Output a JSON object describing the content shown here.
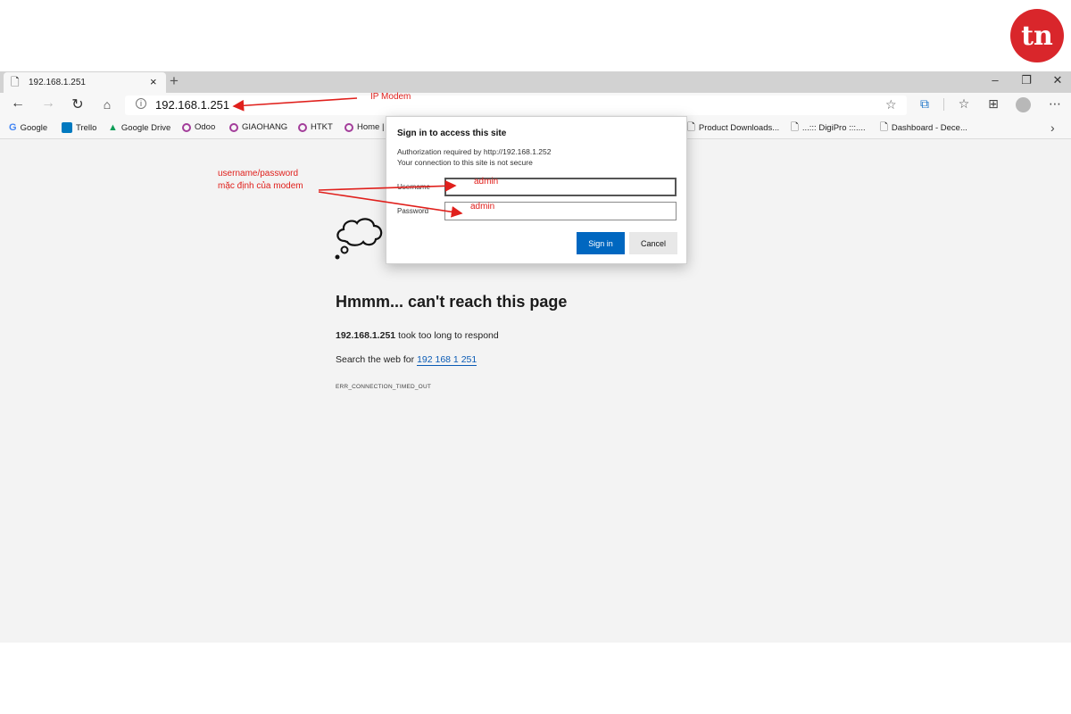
{
  "logo": {
    "text": "tn",
    "color": "#d9262b"
  },
  "browser": {
    "tab": {
      "title": "192.168.1.251",
      "close": "×",
      "new_tab": "+"
    },
    "window_controls": {
      "minimize": "–",
      "restore": "❐",
      "close": "✕"
    },
    "address": {
      "url": "192.168.1.251",
      "info_icon": "i"
    },
    "toolbar_icons": [
      "back-arrow-icon",
      "forward-arrow-icon",
      "refresh-icon",
      "home-icon",
      "star-icon",
      "collections-icon",
      "favorites-icon",
      "extensions-icon",
      "profile-icon",
      "more-icon"
    ],
    "bookmarks": [
      {
        "label": "Google",
        "icon": "google-icon"
      },
      {
        "label": "Trello",
        "icon": "trello-icon"
      },
      {
        "label": "Google Drive",
        "icon": "drive-icon"
      },
      {
        "label": "Odoo",
        "icon": "odoo-icon"
      },
      {
        "label": "GIAOHANG",
        "icon": "odoo-icon"
      },
      {
        "label": "HTKT",
        "icon": "odoo-icon"
      },
      {
        "label": "Home |",
        "icon": "odoo-icon"
      },
      {
        "label": "Product Downloads...",
        "icon": "page-icon"
      },
      {
        "label": "...::: DigiPro :::....",
        "icon": "page-icon"
      },
      {
        "label": "Dashboard - Dece...",
        "icon": "page-icon"
      }
    ],
    "bookmarks_more": "›"
  },
  "error_page": {
    "title": "Hmmm... can't reach this page",
    "host": "192.168.1.251",
    "host_suffix": " took too long to respond",
    "search_prefix": "Search the web for ",
    "search_link": "192 168 1 251",
    "error_code": "ERR_CONNECTION_TIMED_OUT"
  },
  "dialog": {
    "title": "Sign in to access this site",
    "auth_line": "Authorization required by http://192.168.1.252",
    "secure_line": "Your connection to this site is not secure",
    "username_label": "Username",
    "password_label": "Password",
    "username_value": "",
    "password_value": "",
    "signin_label": "Sign in",
    "cancel_label": "Cancel"
  },
  "annotations": {
    "ip_modem": "IP Modem",
    "credentials_line1": "username/password",
    "credentials_line2": "mặc định của modem",
    "username_hint": "admin",
    "password_hint": "admin",
    "color": "#e0201c"
  }
}
